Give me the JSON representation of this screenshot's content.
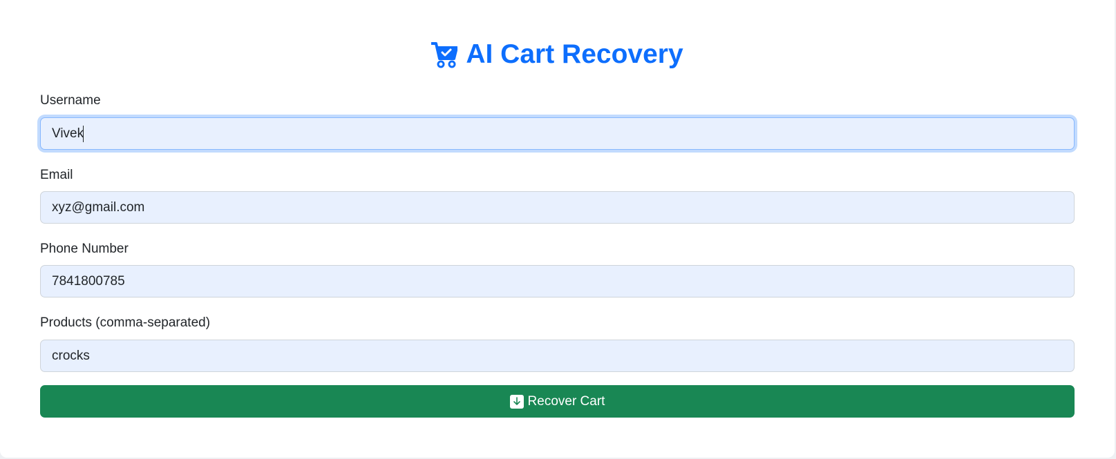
{
  "header": {
    "icon": "cart-check-icon",
    "title": "AI Cart Recovery"
  },
  "form": {
    "username": {
      "label": "Username",
      "value": "Vivek"
    },
    "email": {
      "label": "Email",
      "value": "xyz@gmail.com"
    },
    "phone": {
      "label": "Phone Number",
      "value": "7841800785"
    },
    "products": {
      "label": "Products (comma-separated)",
      "value": "crocks"
    },
    "submit": {
      "label": "Recover Cart",
      "icon": "download-icon"
    }
  },
  "colors": {
    "accent": "#0d6efd",
    "input_bg": "#e8f0fe",
    "button_bg": "#198754"
  }
}
